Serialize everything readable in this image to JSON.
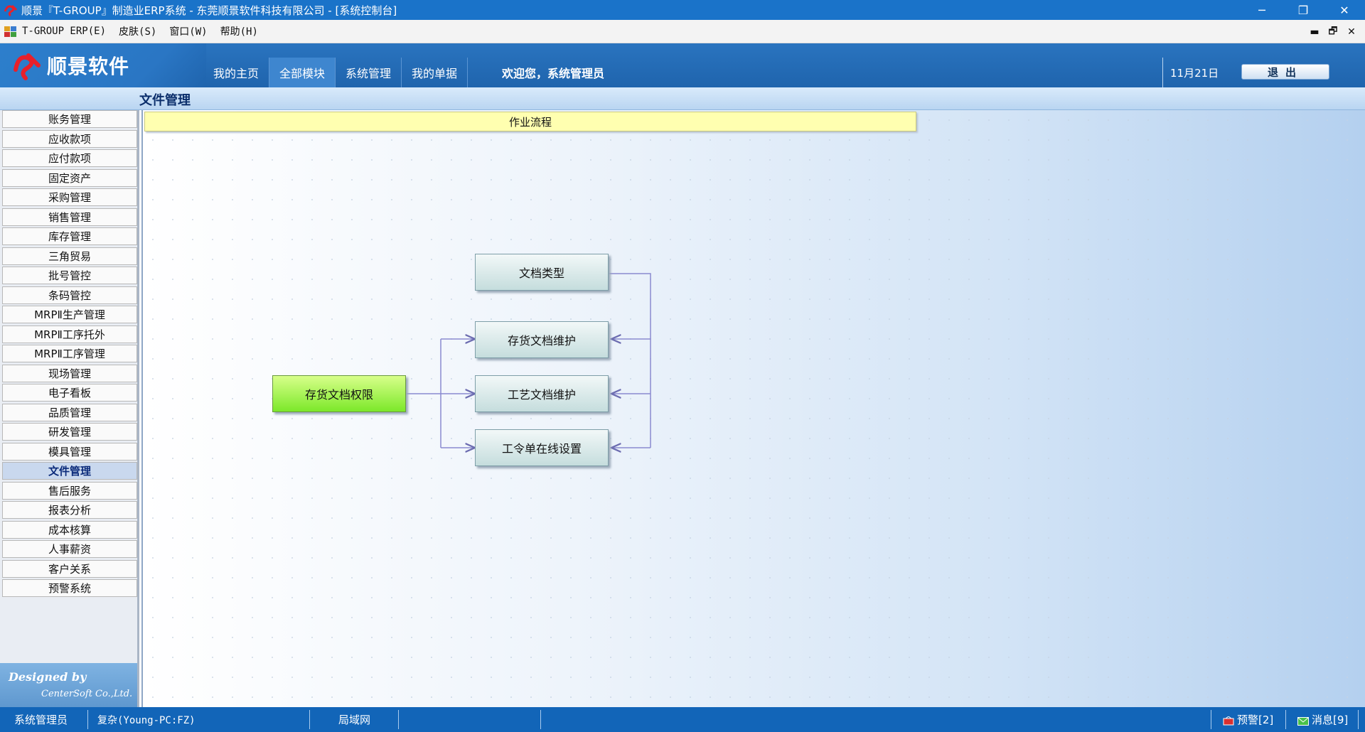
{
  "window": {
    "title": "顺景『T-GROUP』制造业ERP系统 - 东莞顺景软件科技有限公司 - [系统控制台]",
    "controls": {
      "minimize": "─",
      "restore": "❐",
      "close": "✕"
    }
  },
  "menu": {
    "items": [
      "T-GROUP ERP(E)",
      "皮肤(S)",
      "窗口(W)",
      "帮助(H)"
    ],
    "mdi_controls": {
      "minimize": "▬",
      "restore": "🗗",
      "close": "✕"
    }
  },
  "header": {
    "brand": "顺景软件",
    "tabs": [
      "我的主页",
      "全部模块",
      "系统管理",
      "我的单据"
    ],
    "active_tab": "全部模块",
    "welcome": "欢迎您，系统管理员",
    "date": "11月21日",
    "logout": "退出"
  },
  "section": {
    "title": "文件管理"
  },
  "sidebar": {
    "items": [
      "账务管理",
      "应收款项",
      "应付款项",
      "固定资产",
      "采购管理",
      "销售管理",
      "库存管理",
      "三角贸易",
      "批号管控",
      "条码管控",
      "MRPⅡ生产管理",
      "MRPⅡ工序托外",
      "MRPⅡ工序管理",
      "现场管理",
      "电子看板",
      "品质管理",
      "研发管理",
      "模具管理",
      "文件管理",
      "售后服务",
      "报表分析",
      "成本核算",
      "人事薪资",
      "客户关系",
      "预警系统"
    ],
    "active": "文件管理",
    "designed_by": "Designed by",
    "company": "CenterSoft Co.,Ltd."
  },
  "workflow": {
    "header": "作业流程",
    "start_node": "存货文档权限",
    "nodes": [
      "文档类型",
      "存货文档维护",
      "工艺文档维护",
      "工令单在线设置"
    ]
  },
  "statusbar": {
    "user": "系统管理员",
    "db": "复杂(Young-PC:FZ)",
    "network": "局域网",
    "alerts": "预警[2]",
    "messages": "消息[9]"
  },
  "colors": {
    "titlebar": "#1a73c9",
    "header": "#2a74bf",
    "statusbar": "#1265b8",
    "start_node": "#7ce82a",
    "workflow_header": "#ffffb0"
  }
}
